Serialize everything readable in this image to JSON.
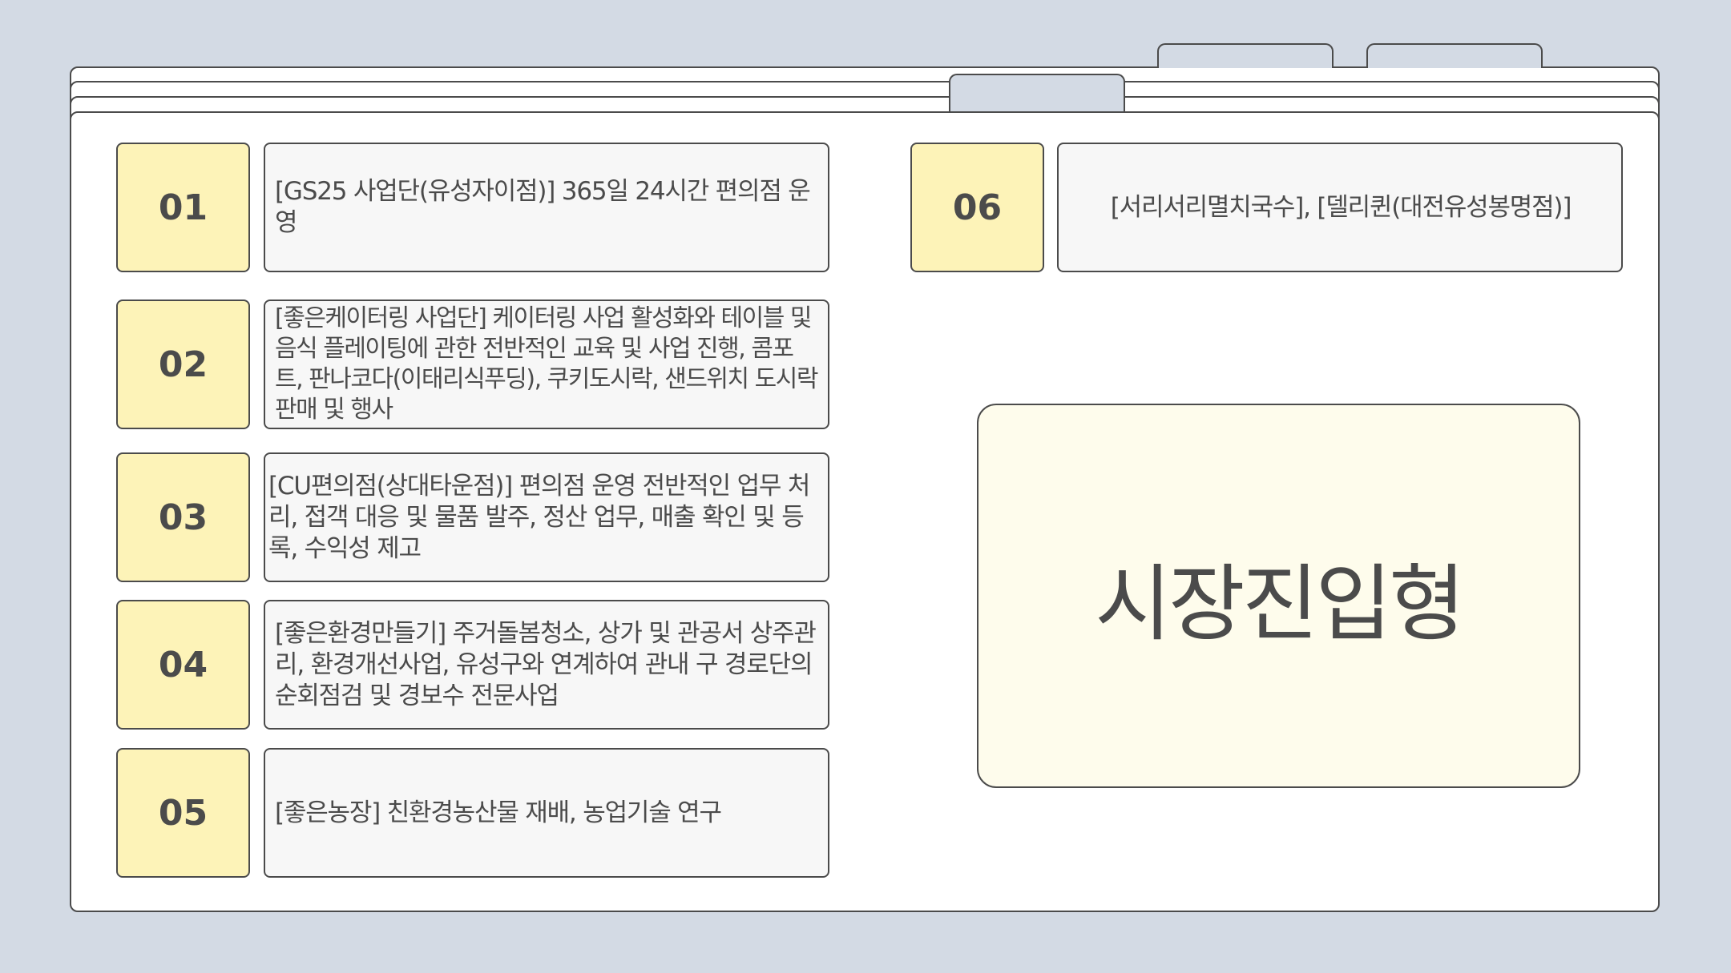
{
  "items": [
    {
      "num": "01",
      "text": "[GS25 사업단(유성자이점)] 365일 24시간 편의점 운영"
    },
    {
      "num": "02",
      "text": "[좋은케이터링 사업단] 케이터링 사업 활성화와 테이블 및 음식 플레이팅에 관한 전반적인 교육 및 사업 진행, 콤포트, 판나코다(이태리식푸딩), 쿠키도시락, 샌드위치 도시락 판매 및 행사"
    },
    {
      "num": "03",
      "text": "[CU편의점(상대타운점)] 편의점 운영 전반적인 업무 처리, 접객 대응 및 물품 발주, 정산 업무, 매출 확인 및 등록, 수익성 제고"
    },
    {
      "num": "04",
      "text": "[좋은환경만들기] 주거돌봄청소, 상가 및 관공서 상주관리, 환경개선사업, 유성구와 연계하여 관내 구 경로단의 순회점검 및 경보수 전문사업"
    },
    {
      "num": "05",
      "text": "[좋은농장] 친환경농산물 재배, 농업기술 연구"
    },
    {
      "num": "06",
      "text": "[서리서리멸치국수], [델리퀸(대전유성봉명점)]"
    }
  ],
  "highlight": {
    "label": "시장진입형"
  },
  "colors": {
    "background": "#d3dae4",
    "number_box": "#fdf3b8",
    "text_box": "#f7f7f7",
    "highlight_box": "#fefcec",
    "outline": "#4b4b4b"
  }
}
